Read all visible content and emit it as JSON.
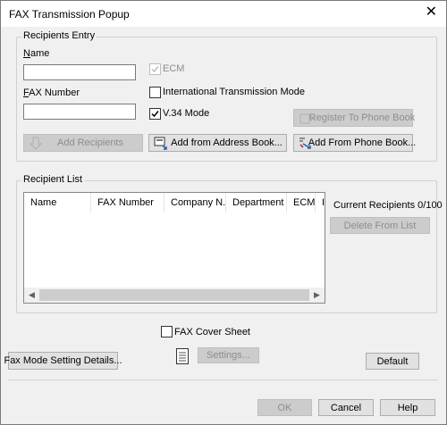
{
  "window": {
    "title": "FAX Transmission Popup",
    "close_glyph": "✕"
  },
  "recipients_entry": {
    "group_label": "Recipients Entry",
    "name_label": "Name",
    "name_value": "",
    "fax_number_label": "FAX Number",
    "fax_number_value": "",
    "ecm": {
      "label": "ECM",
      "checked": true,
      "enabled": false
    },
    "international": {
      "label": "International Transmission Mode",
      "checked": false
    },
    "v34": {
      "label": "V.34 Mode",
      "checked": true
    },
    "register_button": "Register To Phone Book",
    "add_recipients_button": "Add Recipients",
    "add_address_book_button": "Add from Address Book...",
    "add_phone_book_button": "Add From Phone Book..."
  },
  "recipient_list": {
    "group_label": "Recipient List",
    "columns": [
      "Name",
      "FAX Number",
      "Company N...",
      "Department",
      "ECM",
      "In"
    ],
    "rows": [],
    "current_recipients": "Current Recipients 0/100",
    "delete_button": "Delete From List"
  },
  "cover": {
    "label": "FAX Cover Sheet",
    "checked": false,
    "settings_button": "Settings..."
  },
  "fax_mode_button": "Fax Mode Setting Details...",
  "default_button": "Default",
  "footer": {
    "ok": "OK",
    "cancel": "Cancel",
    "help": "Help"
  },
  "colors": {
    "accent": "#0078d7",
    "disabled_text": "#8d8d8d",
    "list_border": "#828790"
  }
}
